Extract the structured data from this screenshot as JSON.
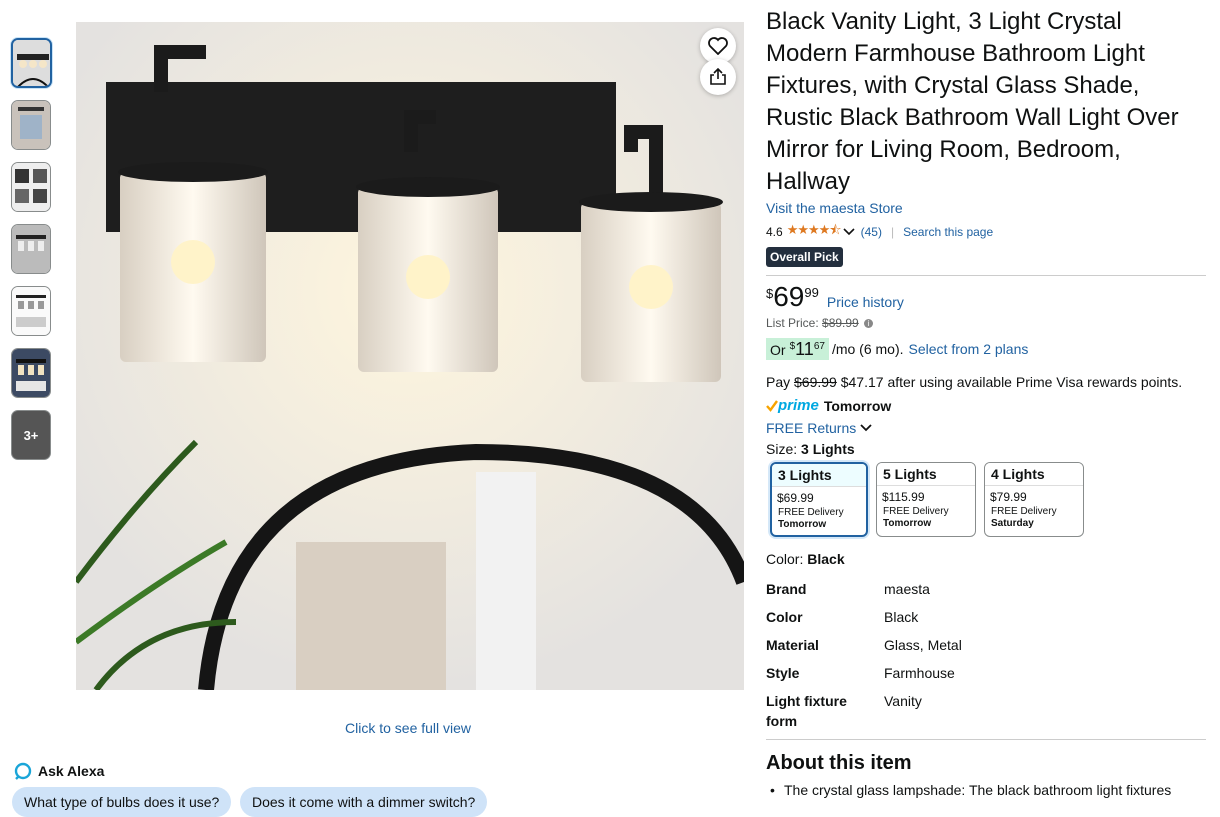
{
  "thumbnails": {
    "more_label": "3+"
  },
  "gallery": {
    "full_view": "Click to see full view"
  },
  "alexa": {
    "title": "Ask Alexa",
    "chips": [
      "What type of bulbs does it use?",
      "Does it come with a dimmer switch?"
    ]
  },
  "product": {
    "title": "Black Vanity Light, 3 Light Crystal Modern Farmhouse Bathroom Light Fixtures, with Crystal Glass Shade, Rustic Black Bathroom Wall Light Over Mirror for Living Room, Bedroom, Hallway",
    "store": "Visit the maesta Store",
    "rating": "4.6",
    "stars": "★★★★⯪",
    "reviews": "(45)",
    "search_page": "Search this page",
    "badge": "Overall Pick"
  },
  "price": {
    "currency": "$",
    "whole": "69",
    "fraction": "99",
    "history": "Price history",
    "list_label": "List Price:",
    "list_value": "$89.99"
  },
  "plans": {
    "or": "Or",
    "cur": "$",
    "whole": "11",
    "fraction": "67",
    "term": "/mo (6 mo).",
    "select": "Select from 2 plans"
  },
  "rewards": {
    "pay": "Pay",
    "old": "$69.99",
    "rest": "$47.17 after using available Prime Visa rewards points."
  },
  "delivery": {
    "prime": "prime",
    "when": "Tomorrow",
    "returns": "FREE Returns"
  },
  "size": {
    "label": "Size:",
    "selected": "3 Lights",
    "options": [
      {
        "name": "3 Lights",
        "price": "$69.99",
        "delivery": "FREE Delivery",
        "day": "Tomorrow"
      },
      {
        "name": "5 Lights",
        "price": "$115.99",
        "delivery": "FREE Delivery",
        "day": "Tomorrow"
      },
      {
        "name": "4 Lights",
        "price": "$79.99",
        "delivery": "FREE Delivery",
        "day": "Saturday"
      }
    ]
  },
  "color": {
    "label": "Color:",
    "selected": "Black"
  },
  "specs": [
    {
      "key": "Brand",
      "value": "maesta"
    },
    {
      "key": "Color",
      "value": "Black"
    },
    {
      "key": "Material",
      "value": "Glass, Metal"
    },
    {
      "key": "Style",
      "value": "Farmhouse"
    },
    {
      "key": "Light fixture form",
      "value": "Vanity"
    }
  ],
  "about": {
    "title": "About this item",
    "bullets": [
      "The crystal glass lampshade: The black bathroom light fixtures"
    ]
  },
  "colors": {
    "link": "#2162a1",
    "star": "#de7921",
    "badge": "#232f3e",
    "plan_bg": "#c8f0d8"
  }
}
